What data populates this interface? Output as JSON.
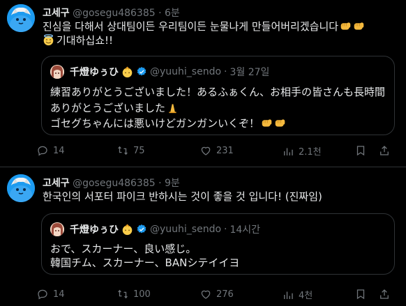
{
  "tweets": [
    {
      "author_name": "고세구",
      "handle": "@gosegu486385",
      "time": "6분",
      "text_line1": "진심을 다해서 상대팀이든 우리팀이든 눈물나게 만들어버리겠습니다",
      "text_line2": "기대하십쇼!!",
      "quote": {
        "author_name": "千燈ゆぅひ",
        "handle": "@yuuhi_sendo",
        "time": "3월 27일",
        "line1": "練習ありがとうございました！あるふぁくん、お相手の皆さんも長時間",
        "line2": "ありがとうございました",
        "line3": "ゴセグちゃんには悪いけどガンガンいくぞ！"
      },
      "stats": {
        "replies": "14",
        "retweets": "75",
        "likes": "231",
        "views": "2.1천"
      }
    },
    {
      "author_name": "고세구",
      "handle": "@gosegu486385",
      "time": "9분",
      "text_line1": "한국인의 서포터 파이크 반하시는 것이 좋을 것 입니다! (진짜임)",
      "quote": {
        "author_name": "千燈ゆぅひ",
        "handle": "@yuuhi_sendo",
        "time": "14시간",
        "line1": "おで、スカーナー、良い感じ。",
        "line2": "韓国チム、スカーナー、BANシテイイヨ"
      },
      "stats": {
        "replies": "14",
        "retweets": "100",
        "likes": "276",
        "views": "4천"
      }
    }
  ],
  "icons": {
    "avatar_main": "cat-avatar-icon",
    "avatar_quote": "girl-avatar-icon",
    "verified": "verified-badge-icon",
    "reply": "reply-icon",
    "retweet": "retweet-icon",
    "like": "heart-icon",
    "views": "views-bar-chart-icon",
    "bookmark": "bookmark-icon",
    "share": "share-icon",
    "emojis": [
      "punch-emoji",
      "halo-smile-emoji",
      "praying-emoji"
    ]
  },
  "colors": {
    "background": "#000000",
    "text": "#e7e9ea",
    "muted": "#71767b",
    "border": "#2f3336",
    "verified": "#1d9bf0"
  }
}
